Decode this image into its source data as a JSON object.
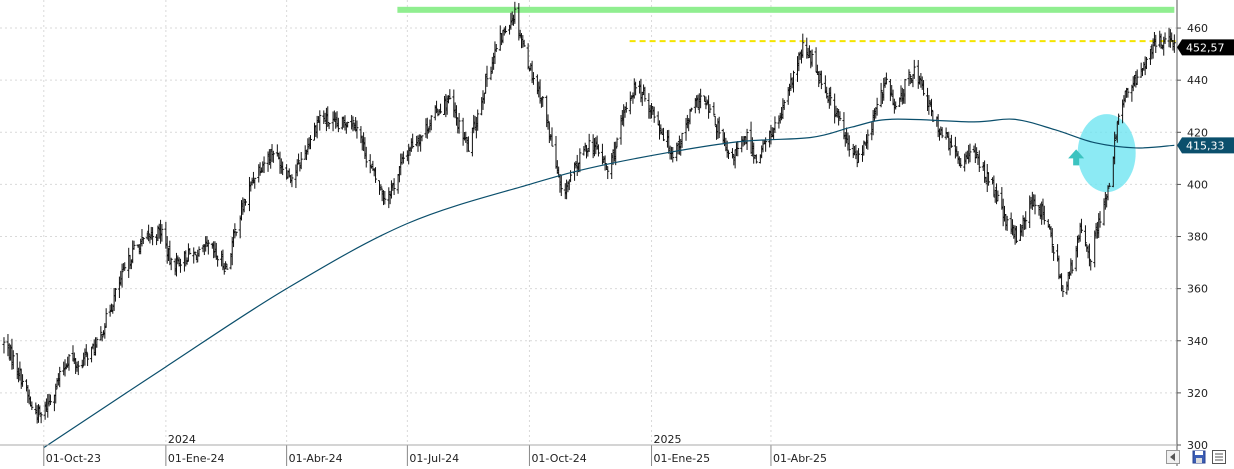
{
  "chart_data": {
    "type": "ohlc",
    "title": "",
    "ylim": [
      300,
      470
    ],
    "y_ticks": [
      300,
      320,
      340,
      360,
      380,
      400,
      420,
      440,
      460
    ],
    "x_tick_labels": [
      "01-Oct-23",
      "01-Ene-24",
      "01-Abr-24",
      "01-Jul-24",
      "01-Oct-24",
      "01-Ene-25",
      "01-Abr-25"
    ],
    "year_labels": [
      "2024",
      "2025"
    ],
    "grid": true,
    "price_series": {
      "name": "",
      "anchors": [
        [
          "2023-09-01",
          339
        ],
        [
          "2023-09-08",
          333
        ],
        [
          "2023-09-15",
          325
        ],
        [
          "2023-09-22",
          314
        ],
        [
          "2023-09-29",
          311
        ],
        [
          "2023-10-06",
          318
        ],
        [
          "2023-10-13",
          326
        ],
        [
          "2023-10-20",
          334
        ],
        [
          "2023-10-27",
          330
        ],
        [
          "2023-11-03",
          335
        ],
        [
          "2023-11-10",
          338
        ],
        [
          "2023-11-17",
          348
        ],
        [
          "2023-11-24",
          358
        ],
        [
          "2023-12-01",
          367
        ],
        [
          "2023-12-08",
          375
        ],
        [
          "2023-12-15",
          378
        ],
        [
          "2023-12-22",
          381
        ],
        [
          "2023-12-29",
          382
        ],
        [
          "2024-01-05",
          369
        ],
        [
          "2024-01-12",
          371
        ],
        [
          "2024-01-19",
          373
        ],
        [
          "2024-01-26",
          373
        ],
        [
          "2024-02-02",
          376
        ],
        [
          "2024-02-09",
          372
        ],
        [
          "2024-02-16",
          368
        ],
        [
          "2024-02-23",
          384
        ],
        [
          "2024-03-01",
          394
        ],
        [
          "2024-03-08",
          404
        ],
        [
          "2024-03-15",
          409
        ],
        [
          "2024-03-22",
          413
        ],
        [
          "2024-03-29",
          407
        ],
        [
          "2024-04-05",
          403
        ],
        [
          "2024-04-12",
          409
        ],
        [
          "2024-04-19",
          418
        ],
        [
          "2024-04-26",
          426
        ],
        [
          "2024-05-03",
          424
        ],
        [
          "2024-05-10",
          422
        ],
        [
          "2024-05-17",
          425
        ],
        [
          "2024-05-24",
          423
        ],
        [
          "2024-05-31",
          411
        ],
        [
          "2024-06-07",
          402
        ],
        [
          "2024-06-14",
          395
        ],
        [
          "2024-06-21",
          400
        ],
        [
          "2024-06-28",
          410
        ],
        [
          "2024-07-05",
          416
        ],
        [
          "2024-07-12",
          419
        ],
        [
          "2024-07-19",
          425
        ],
        [
          "2024-07-26",
          430
        ],
        [
          "2024-08-02",
          432
        ],
        [
          "2024-08-09",
          422
        ],
        [
          "2024-08-16",
          414
        ],
        [
          "2024-08-23",
          427
        ],
        [
          "2024-08-30",
          441
        ],
        [
          "2024-09-06",
          452
        ],
        [
          "2024-09-13",
          460
        ],
        [
          "2024-09-20",
          466
        ],
        [
          "2024-09-27",
          452
        ],
        [
          "2024-10-04",
          441
        ],
        [
          "2024-10-11",
          432
        ],
        [
          "2024-10-18",
          415
        ],
        [
          "2024-10-25",
          396
        ],
        [
          "2024-11-01",
          402
        ],
        [
          "2024-11-08",
          410
        ],
        [
          "2024-11-15",
          416
        ],
        [
          "2024-11-22",
          413
        ],
        [
          "2024-11-29",
          405
        ],
        [
          "2024-12-06",
          416
        ],
        [
          "2024-12-13",
          430
        ],
        [
          "2024-12-20",
          438
        ],
        [
          "2024-12-27",
          433
        ],
        [
          "2025-01-03",
          427
        ],
        [
          "2025-01-10",
          419
        ],
        [
          "2025-01-17",
          412
        ],
        [
          "2025-01-24",
          418
        ],
        [
          "2025-01-31",
          428
        ],
        [
          "2025-02-07",
          433
        ],
        [
          "2025-02-14",
          428
        ],
        [
          "2025-02-21",
          420
        ],
        [
          "2025-02-28",
          410
        ],
        [
          "2025-03-07",
          413
        ],
        [
          "2025-03-14",
          418
        ],
        [
          "2025-03-21",
          410
        ],
        [
          "2025-03-28",
          416
        ],
        [
          "2025-04-04",
          422
        ],
        [
          "2025-04-11",
          429
        ],
        [
          "2025-04-18",
          442
        ],
        [
          "2025-04-25",
          452
        ],
        [
          "2025-05-02",
          448
        ],
        [
          "2025-05-09",
          440
        ],
        [
          "2025-05-16",
          432
        ],
        [
          "2025-05-23",
          424
        ],
        [
          "2025-05-30",
          413
        ],
        [
          "2025-06-06",
          410
        ],
        [
          "2025-06-13",
          418
        ],
        [
          "2025-06-20",
          430
        ],
        [
          "2025-06-27",
          440
        ],
        [
          "2025-07-04",
          428
        ],
        [
          "2025-07-11",
          438
        ],
        [
          "2025-07-18",
          444
        ],
        [
          "2025-07-25",
          436
        ],
        [
          "2025-08-01",
          426
        ],
        [
          "2025-08-08",
          420
        ],
        [
          "2025-08-15",
          414
        ],
        [
          "2025-08-22",
          408
        ],
        [
          "2025-08-29",
          414
        ],
        [
          "2025-09-05",
          408
        ],
        [
          "2025-09-12",
          402
        ],
        [
          "2025-09-19",
          394
        ],
        [
          "2025-09-26",
          384
        ],
        [
          "2025-10-03",
          380
        ],
        [
          "2025-10-10",
          388
        ],
        [
          "2025-10-17",
          394
        ],
        [
          "2025-10-24",
          388
        ],
        [
          "2025-10-31",
          376
        ],
        [
          "2025-11-07",
          360
        ],
        [
          "2025-11-14",
          368
        ],
        [
          "2025-11-21",
          384
        ],
        [
          "2025-11-28",
          372
        ],
        [
          "2025-12-05",
          388
        ],
        [
          "2025-12-12",
          398
        ],
        [
          "2025-12-19",
          428
        ],
        [
          "2025-12-26",
          436
        ],
        [
          "2026-01-02",
          440
        ],
        [
          "2026-01-09",
          448
        ],
        [
          "2026-01-16",
          454
        ],
        [
          "2026-01-23",
          456
        ],
        [
          "2026-01-30",
          452.57
        ]
      ],
      "last_value_label": "452,57",
      "last_value_label_color": "#000000"
    },
    "moving_average": {
      "name": "",
      "color": "#0b4f6c",
      "points": [
        [
          "2023-10-01",
          299
        ],
        [
          "2024-01-01",
          330
        ],
        [
          "2024-04-01",
          360
        ],
        [
          "2024-07-01",
          385
        ],
        [
          "2024-10-01",
          400
        ],
        [
          "2024-12-01",
          408
        ],
        [
          "2025-03-01",
          416
        ],
        [
          "2025-05-01",
          418
        ],
        [
          "2025-06-01",
          422
        ],
        [
          "2025-07-01",
          425
        ],
        [
          "2025-09-01",
          424
        ],
        [
          "2025-10-01",
          425
        ],
        [
          "2025-11-01",
          421
        ],
        [
          "2025-12-01",
          416
        ],
        [
          "2026-01-01",
          414
        ],
        [
          "2026-01-30",
          415
        ]
      ],
      "last_value_label": "415,33",
      "last_value_label_color": "#0b4f6c"
    },
    "annotations": {
      "resistance_green": {
        "value": 467,
        "color": "#90ee90",
        "x_range": [
          "2024-06-28",
          "2026-01-30"
        ]
      },
      "resistance_yellow": {
        "value": 455,
        "color": "#f5e400",
        "x_range": [
          "2024-12-20",
          "2026-01-30"
        ]
      },
      "ellipse_center": [
        "2025-12-10",
        412
      ],
      "ellipse_color": "#66e3f0",
      "arrow_center": [
        "2025-11-17",
        410
      ],
      "arrow_color": "#3cc3c0"
    }
  },
  "footer": {
    "icons": [
      "scroll-left-icon",
      "save-icon",
      "properties-icon"
    ]
  }
}
